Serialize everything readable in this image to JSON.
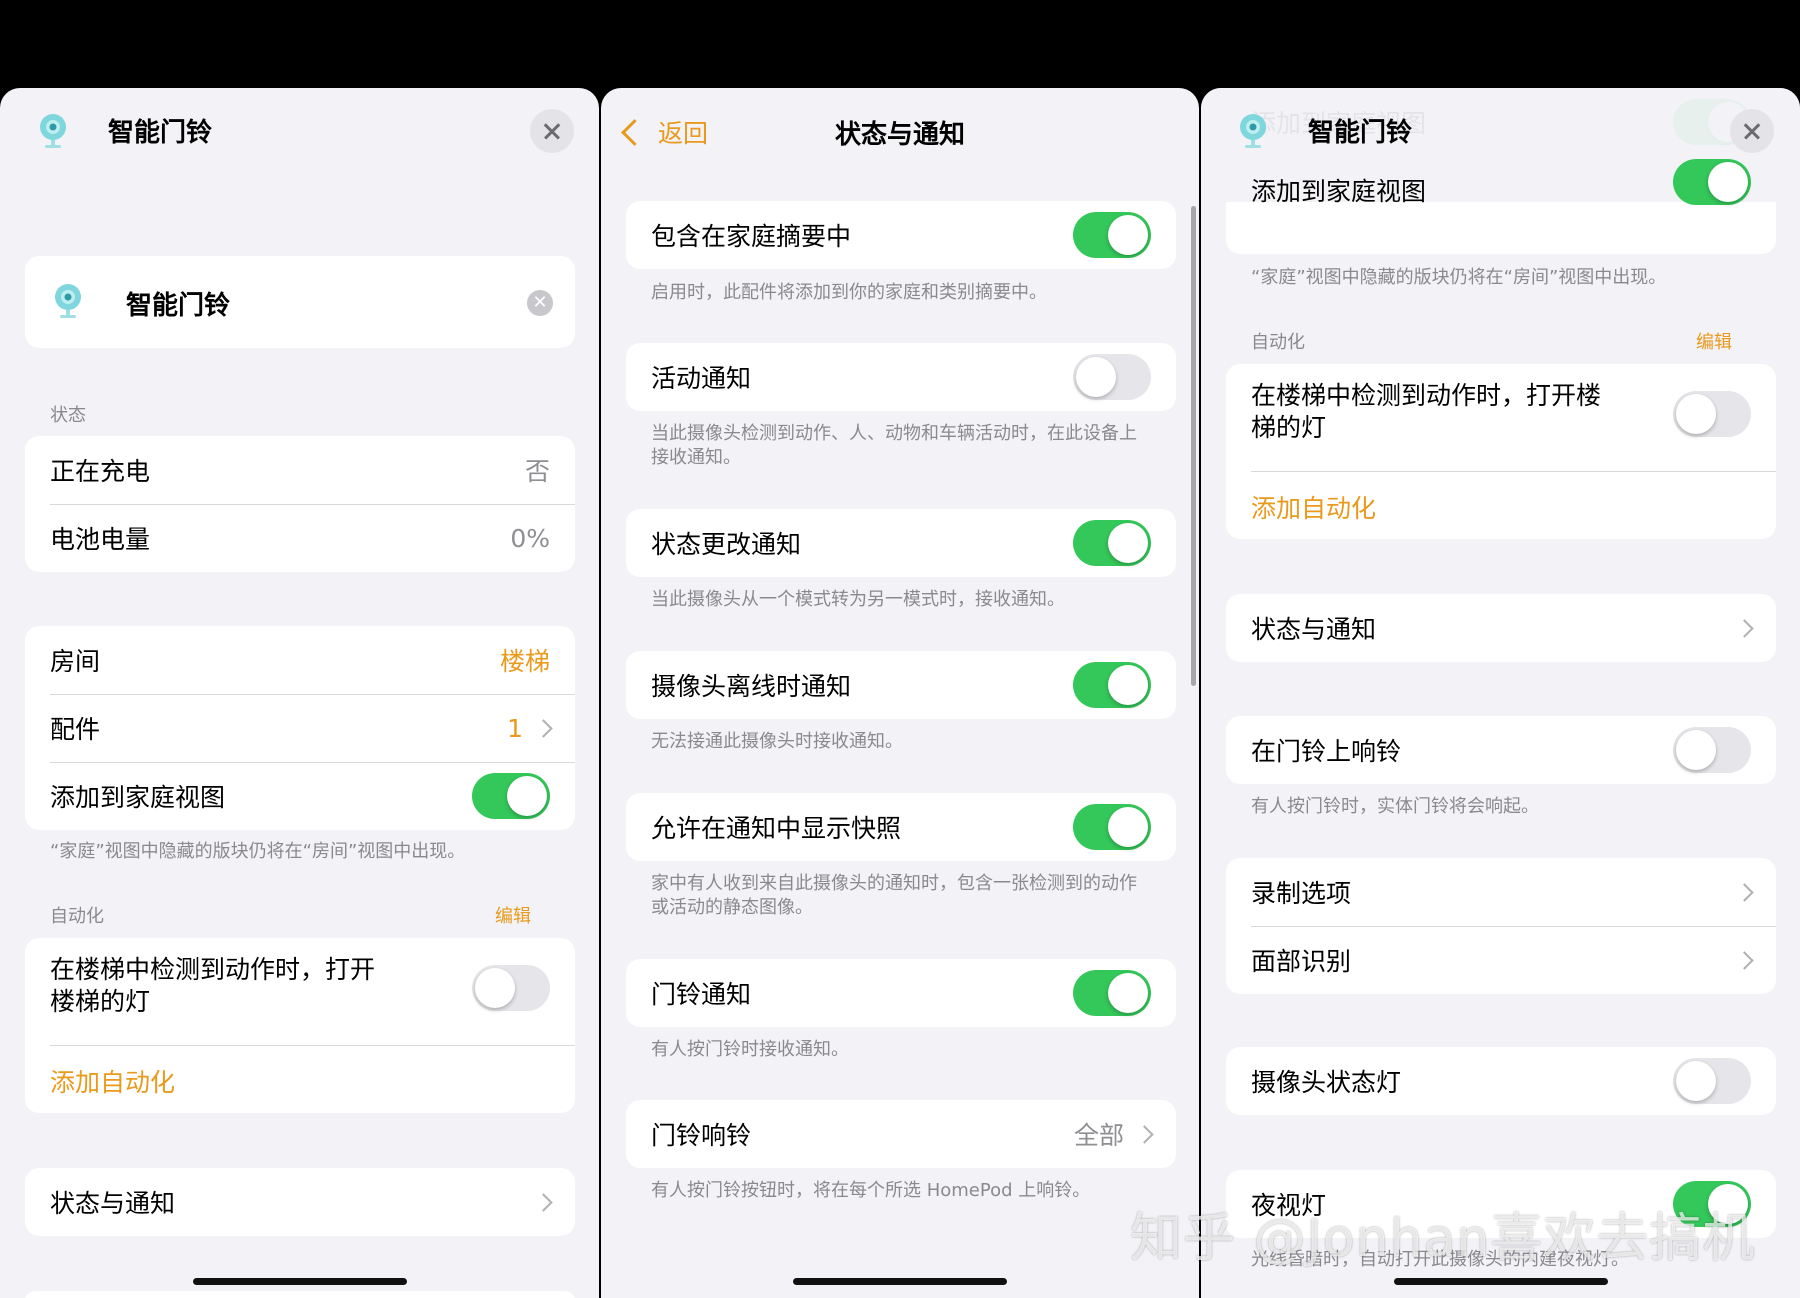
{
  "panel1": {
    "title": "智能门铃",
    "card_name": "智能门铃",
    "status_header": "状态",
    "status_rows": [
      {
        "label": "正在充电",
        "value": "否"
      },
      {
        "label": "电池电量",
        "value": "0%"
      }
    ],
    "room_label": "房间",
    "room_value": "楼梯",
    "accessory_label": "配件",
    "accessory_value": "1",
    "add_home_label": "添加到家庭视图",
    "add_home_on": true,
    "add_home_note": "“家庭”视图中隐藏的版块仍将在“房间”视图中出现。",
    "automation_header": "自动化",
    "automation_edit": "编辑",
    "automation_item": "在楼梯中检测到动作时，打开楼梯的灯",
    "automation_item_on": false,
    "add_automation": "添加自动化",
    "status_notify": "状态与通知"
  },
  "panel2": {
    "back": "返回",
    "title": "状态与通知",
    "items": [
      {
        "label": "包含在家庭摘要中",
        "on": true,
        "note": "启用时，此配件将添加到你的家庭和类别摘要中。"
      },
      {
        "label": "活动通知",
        "on": false,
        "note": "当此摄像头检测到动作、人、动物和车辆活动时，在此设备上接收通知。"
      },
      {
        "label": "状态更改通知",
        "on": true,
        "note": "当此摄像头从一个模式转为另一模式时，接收通知。"
      },
      {
        "label": "摄像头离线时通知",
        "on": true,
        "note": "无法接通此摄像头时接收通知。"
      },
      {
        "label": "允许在通知中显示快照",
        "on": true,
        "note": "家中有人收到来自此摄像头的通知时，包含一张检测到的动作或活动的静态图像。"
      },
      {
        "label": "门铃通知",
        "on": true,
        "note": "有人按门铃时接收通知。"
      }
    ],
    "chime_label": "门铃响铃",
    "chime_value": "全部",
    "chime_note": "有人按门铃按钮时，将在每个所选 HomePod 上响铃。"
  },
  "panel3": {
    "title": "智能门铃",
    "add_home_label": "添加到家庭视图",
    "add_home_on": true,
    "add_home_note": "“家庭”视图中隐藏的版块仍将在“房间”视图中出现。",
    "automation_header": "自动化",
    "automation_edit": "编辑",
    "automation_item": "在楼梯中检测到动作时，打开楼梯的灯",
    "automation_item_on": false,
    "add_automation": "添加自动化",
    "status_notify": "状态与通知",
    "ring_label": "在门铃上响铃",
    "ring_on": false,
    "ring_note": "有人按门铃时，实体门铃将会响起。",
    "recording": "录制选项",
    "face": "面部识别",
    "cam_light": "摄像头状态灯",
    "cam_light_on": false,
    "night": "夜视灯",
    "night_on": true,
    "night_note": "光线昏暗时，自动打开此摄像头的内建夜视灯。"
  },
  "watermark": "知乎 @Jonhan喜欢去搞机",
  "colors": {
    "accent": "#e99a1c",
    "toggle_on": "#34c759",
    "background": "#f2f2f7"
  }
}
